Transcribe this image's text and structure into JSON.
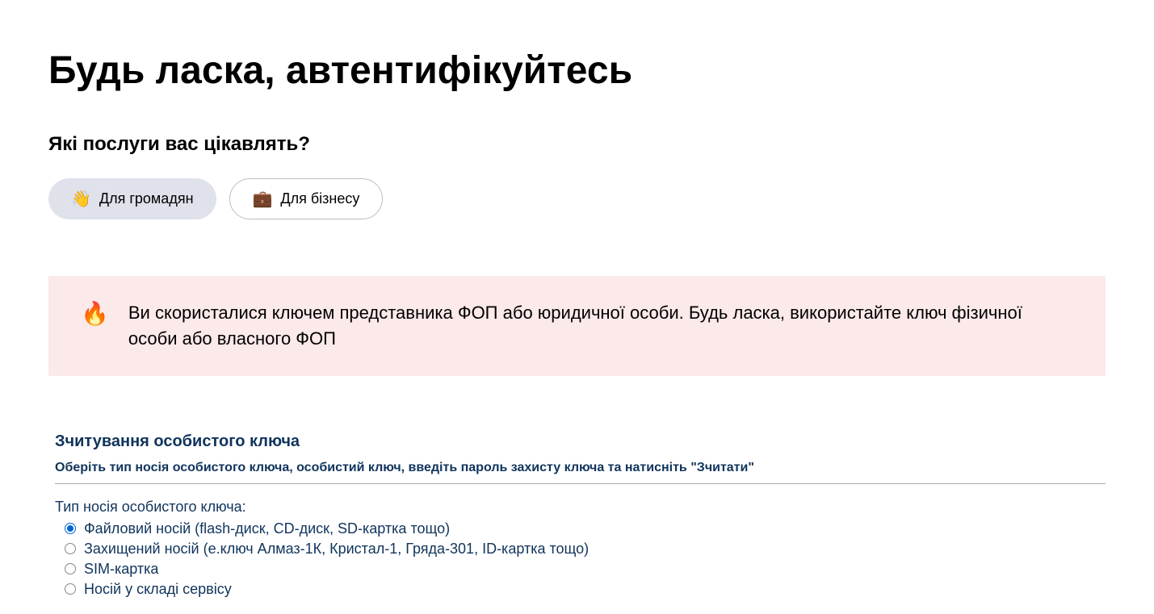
{
  "page": {
    "title": "Будь ласка, автентифікуйтесь",
    "subtitle": "Які послуги вас цікавлять?"
  },
  "serviceButtons": {
    "citizens": {
      "icon": "👋",
      "label": "Для громадян"
    },
    "business": {
      "icon": "💼",
      "label": "Для бізнесу"
    }
  },
  "alert": {
    "icon": "🔥",
    "text": "Ви скористалися ключем представника ФОП або юридичної особи. Будь ласка, використайте ключ фізичної особи або власного ФОП"
  },
  "keySection": {
    "title": "Зчитування особистого ключа",
    "instruction": "Оберіть тип носія особистого ключа, особистий ключ, введіть пароль захисту ключа та натисніть \"Зчитати\"",
    "mediaTypeLabel": "Тип носія особистого ключа:",
    "options": [
      "Файловий носій (flash-диск, CD-диск, SD-картка тощо)",
      "Захищений носій (е.ключ Алмаз-1К, Кристал-1, Гряда-301, ID-картка тощо)",
      "SIM-картка",
      "Носій у складі сервісу"
    ]
  }
}
